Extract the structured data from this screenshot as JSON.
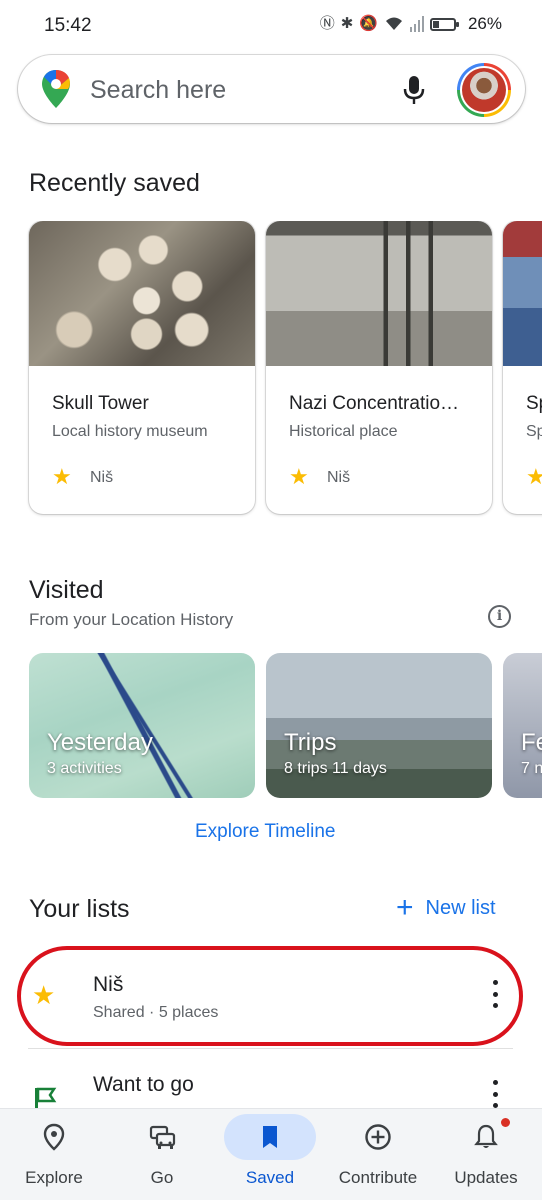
{
  "status_bar": {
    "time": "15:42",
    "battery_percent": "26%",
    "icons": [
      "nfc-icon",
      "bluetooth-icon",
      "mute-icon",
      "wifi-icon",
      "signal-icon",
      "battery-icon"
    ]
  },
  "search": {
    "placeholder": "Search here"
  },
  "recently_saved": {
    "title": "Recently saved",
    "cards": [
      {
        "title": "Skull Tower",
        "subtitle": "Local history museum",
        "list": "Niš"
      },
      {
        "title": "Nazi Concentratio…",
        "subtitle": "Historical place",
        "list": "Niš"
      },
      {
        "title": "Sp",
        "subtitle": "Sp",
        "list": ""
      }
    ]
  },
  "visited": {
    "title": "Visited",
    "subtitle": "From your Location History",
    "cards": [
      {
        "title": "Yesterday",
        "subtitle": "3 activities"
      },
      {
        "title": "Trips",
        "subtitle": "8 trips  11 days"
      },
      {
        "title": "Fe",
        "subtitle": "7 n"
      }
    ],
    "explore_link": "Explore Timeline"
  },
  "your_lists": {
    "title": "Your lists",
    "new_list_label": "New list",
    "items": [
      {
        "title": "Niš",
        "subtitle": "Shared · 5 places",
        "icon": "star-icon"
      },
      {
        "title": "Want to go",
        "subtitle": "",
        "icon": "flag-icon"
      }
    ]
  },
  "bottom_nav": {
    "items": [
      {
        "label": "Explore",
        "icon": "location-pin-icon",
        "active": false
      },
      {
        "label": "Go",
        "icon": "car-icon",
        "active": false
      },
      {
        "label": "Saved",
        "icon": "bookmark-icon",
        "active": true
      },
      {
        "label": "Contribute",
        "icon": "add-circle-icon",
        "active": false
      },
      {
        "label": "Updates",
        "icon": "bell-icon",
        "active": false,
        "has_notification": true
      }
    ]
  },
  "colors": {
    "accent": "#1a73e8",
    "star": "#fbbc04",
    "highlight_ring": "#d9121c",
    "flag": "#188038",
    "nav_active_pill": "#d3e3fd"
  }
}
